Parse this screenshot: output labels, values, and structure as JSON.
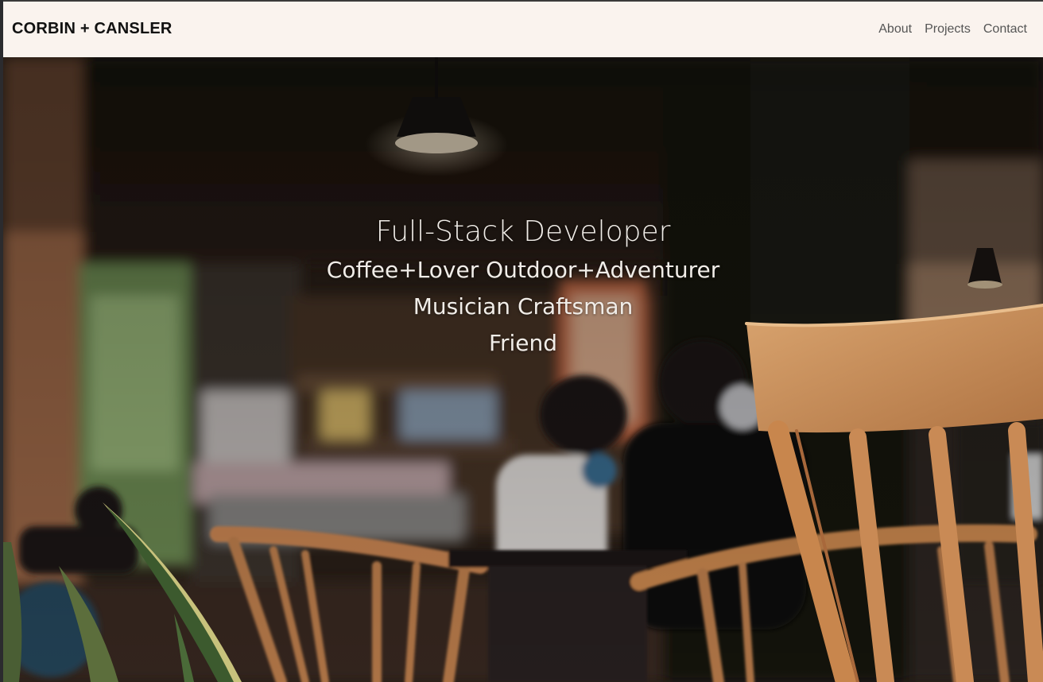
{
  "navbar": {
    "brand": "CORBIN + CANSLER",
    "links": [
      "About",
      "Projects",
      "Contact"
    ],
    "background": "#faf3ee"
  },
  "hero": {
    "title": "Full-Stack Developer",
    "lines": [
      "Coffee+Lover Outdoor+Adventurer",
      "Musician Craftsman",
      "Friend"
    ],
    "text_color": "#f1ede8",
    "background_description_icon": "cafe-photo"
  }
}
